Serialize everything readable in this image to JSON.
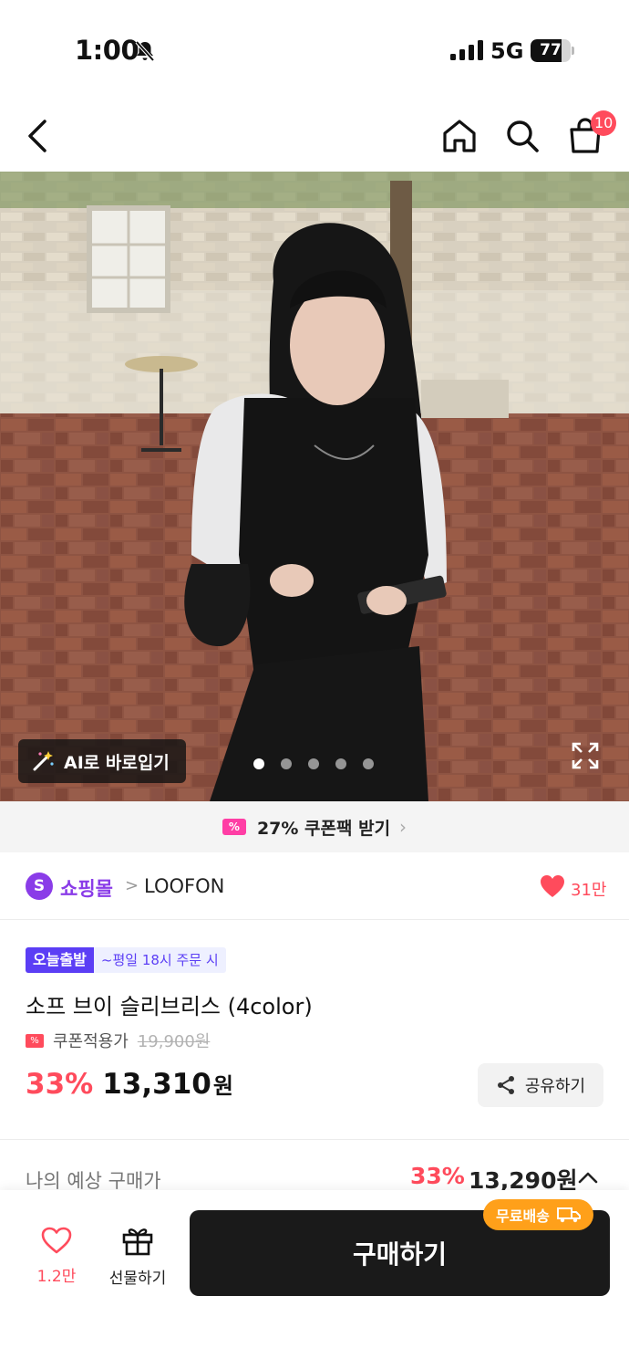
{
  "status_bar": {
    "time": "1:00",
    "network": "5G",
    "battery": "77",
    "battery_level": 0.77
  },
  "header": {
    "cart_count": "10"
  },
  "hero": {
    "ai_button": "AI로 바로입기",
    "slide_count": 5,
    "active_slide": 0
  },
  "coupon_banner": {
    "text": "27% 쿠폰팩 받기"
  },
  "shop": {
    "logo_letter": "S",
    "name": "쇼핑몰",
    "separator": ">",
    "brand": "LOOFON",
    "likes": "31만"
  },
  "product": {
    "badge_today": "오늘출발",
    "badge_time": "~평일 18시 주문 시",
    "title": "소프 브이 슬리브리스 (4color)",
    "coupon_label": "쿠폰적용가",
    "original_price": "19,900원",
    "discount": "33%",
    "price": "13,310",
    "price_unit": "원",
    "share_label": "공유하기"
  },
  "estimate": {
    "label": "나의 예상 구매가",
    "discount": "33%",
    "price": "13,290원"
  },
  "bottom_bar": {
    "wish_count": "1.2만",
    "gift_label": "선물하기",
    "buy_label": "구매하기",
    "free_shipping": "무료배송"
  },
  "colors": {
    "accent_red": "#ff4b5c",
    "brand_purple": "#8a3ce8",
    "badge_blue": "#5b3ef5",
    "buy_black": "#1a1a1a",
    "shipping_orange": "#ffa01a",
    "coupon_pink": "#ff3ea5"
  }
}
